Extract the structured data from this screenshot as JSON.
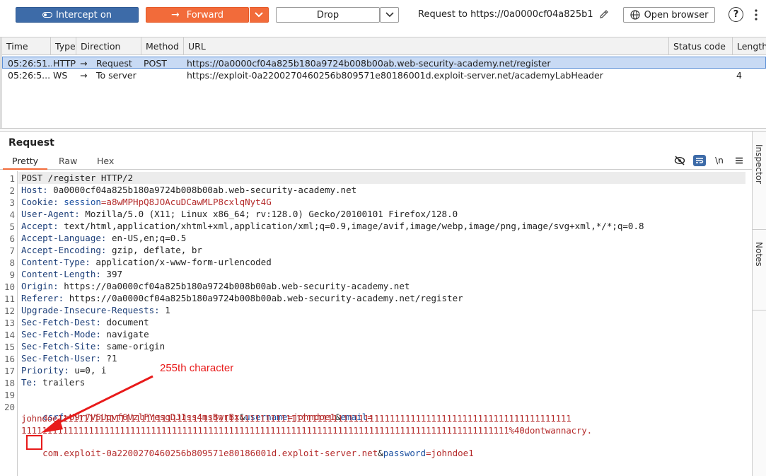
{
  "toolbar": {
    "intercept_label": "Intercept on",
    "forward_label": "Forward",
    "drop_label": "Drop",
    "request_to": "Request to https://0a0000cf04a825b180...",
    "open_browser_label": "Open browser",
    "help_label": "?"
  },
  "history": {
    "columns": [
      "Time",
      "Type",
      "Direction",
      "Method",
      "URL",
      "Status code",
      "Length"
    ],
    "rows": [
      {
        "time": "05:26:51...",
        "type": "HTTP",
        "direction": "Request",
        "method": "POST",
        "url": "https://0a0000cf04a825b180a9724b008b00ab.web-security-academy.net/register",
        "status": "",
        "length": ""
      },
      {
        "time": "05:26:5...",
        "type": "WS",
        "direction": "To server",
        "method": "",
        "url": "https://exploit-0a2200270460256b809571e80186001d.exploit-server.net/academyLabHeader",
        "status": "",
        "length": "4"
      }
    ]
  },
  "request": {
    "title": "Request",
    "tabs": [
      "Pretty",
      "Raw",
      "Hex"
    ],
    "newline_label": "\\n",
    "lines": {
      "l1": "POST /register HTTP/2",
      "l2k": "Host:",
      "l2v": " 0a0000cf04a825b180a9724b008b00ab.web-security-academy.net",
      "l3k": "Cookie:",
      "l3a": " session",
      "l3b": "=a8wMPHpQ8JOAcuDCawMLP8cxlqNyt4G",
      "l4k": "User-Agent:",
      "l4v": " Mozilla/5.0 (X11; Linux x86_64; rv:128.0) Gecko/20100101 Firefox/128.0",
      "l5k": "Accept:",
      "l5v": " text/html,application/xhtml+xml,application/xml;q=0.9,image/avif,image/webp,image/png,image/svg+xml,*/*;q=0.8",
      "l6k": "Accept-Language:",
      "l6v": " en-US,en;q=0.5",
      "l7k": "Accept-Encoding:",
      "l7v": " gzip, deflate, br",
      "l8k": "Content-Type:",
      "l8v": " application/x-www-form-urlencoded",
      "l9k": "Content-Length:",
      "l9v": " 397",
      "l10k": "Origin:",
      "l10v": " https://0a0000cf04a825b180a9724b008b00ab.web-security-academy.net",
      "l11k": "Referer:",
      "l11v": " https://0a0000cf04a825b180a9724b008b00ab.web-security-academy.net/register",
      "l12k": "Upgrade-Insecure-Requests:",
      "l12v": " 1",
      "l13k": "Sec-Fetch-Dest:",
      "l13v": " document",
      "l14k": "Sec-Fetch-Mode:",
      "l14v": " navigate",
      "l15k": "Sec-Fetch-Site:",
      "l15v": " same-origin",
      "l16k": "Sec-Fetch-User:",
      "l16v": " ?1",
      "l17k": "Priority:",
      "l17v": " u=0, i",
      "l18k": "Te:",
      "l18v": " trailers",
      "body_a": "csrf",
      "body_b": "=U9r7V5Uqvf6VzlFYesgDJIss4msBwrBx",
      "body_c": "&",
      "body_d": "username",
      "body_e": "=johndoe1",
      "body_f": "&",
      "body_g": "email",
      "body_h": "=",
      "wrap1": "johndoe111111111111111111111111111111111111111111111111111111111111111111111111111111111111111111111111111",
      "wrap2": "1111111111111111111111111111111111111111111111111111111111111111111111111111111111111111111111%40dontwannacry.",
      "wrap3a": "com.exploit-0a2200270460256b809571e80186001d.exploit-server.net",
      "wrap3b": "&",
      "wrap3c": "password",
      "wrap3d": "=johndoe1"
    }
  },
  "sidebar": {
    "inspector": "Inspector",
    "notes": "Notes"
  },
  "annotation": {
    "text": "255th character"
  },
  "colors": {
    "intercept": "#3d6ba8",
    "forward": "#f26b3a",
    "annotation": "#e81a1a"
  }
}
